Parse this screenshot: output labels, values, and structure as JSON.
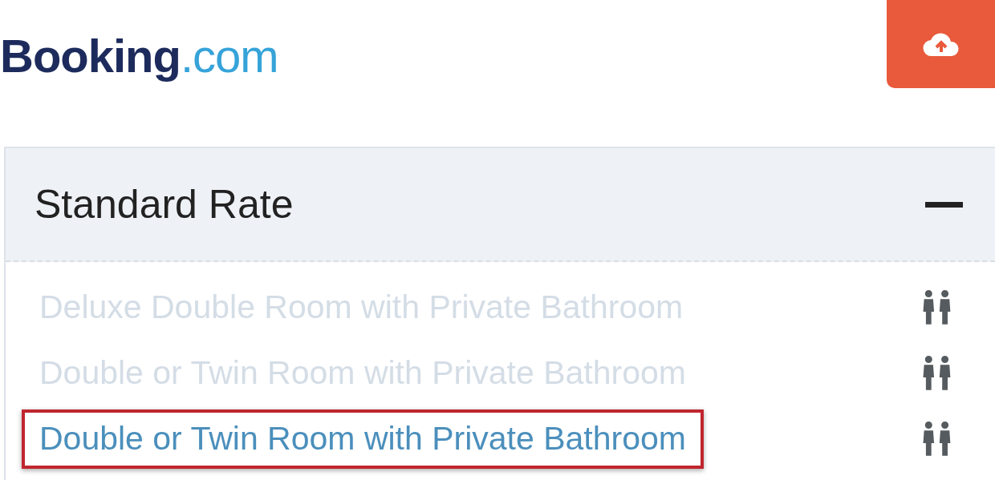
{
  "logo": {
    "name": "Booking",
    "suffix": ".com"
  },
  "panel": {
    "title": "Standard Rate",
    "expanded": true,
    "rooms": [
      {
        "name": "Deluxe Double Room with Private Bathroom",
        "selected": false
      },
      {
        "name": "Double or Twin Room with Private Bathroom",
        "selected": false
      },
      {
        "name": "Double or Twin Room with Private Bathroom",
        "selected": true
      }
    ]
  }
}
